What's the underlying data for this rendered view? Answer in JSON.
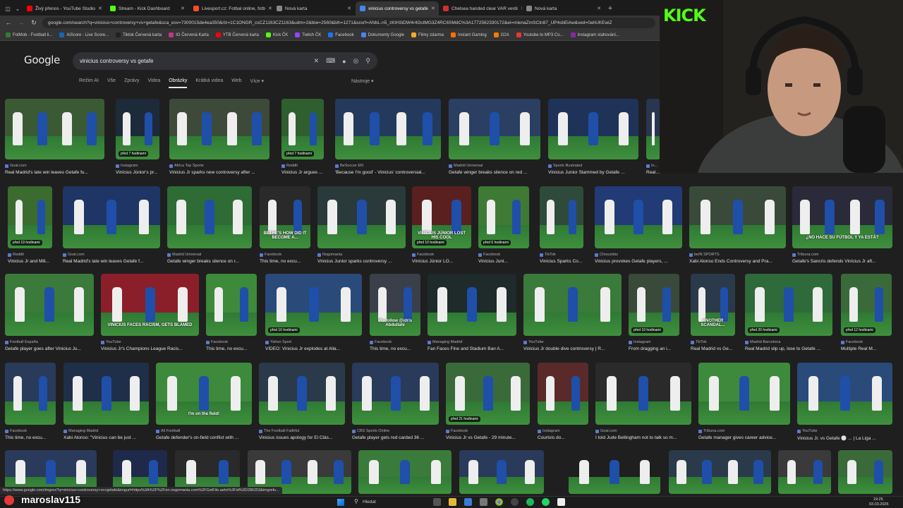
{
  "browser": {
    "tabs": [
      {
        "label": "Živý přenos - YouTube Studio",
        "color": "#ff0000"
      },
      {
        "label": "Stream - Kick Dashboard",
        "color": "#53fc18"
      },
      {
        "label": "Livesport.cz: Fotbal online, fotb",
        "color": "#ff4b2b"
      },
      {
        "label": "Nová karta",
        "color": "#888888"
      },
      {
        "label": "vinicius controversy vs getafe",
        "color": "#4285f4",
        "active": true
      },
      {
        "label": "Chelsea handed clear VAR verdi",
        "color": "#d32f2f"
      },
      {
        "label": "Nová karta",
        "color": "#888888"
      }
    ],
    "new_tab": "+",
    "url": "google.com/search?q=vinicius+controversy+vs+getafe&sca_esv=7300015de4ea350&rlz=1C1ONGR_csCZ1163CZ1163&udm=2&biw=2560&bih=1271&sxsrf=ANbL-n5_zKtH3iDW4r4GctMG3Z4RC6SMdC%3A1772562330172&ei=mienaZmSCtn87_UP4sbEiAw&ved=0ahUKEwiZ",
    "bookmarks": [
      {
        "label": "FotMob - Football li...",
        "color": "#2e7d32"
      },
      {
        "label": "AiScore - Live Score...",
        "color": "#1565c0"
      },
      {
        "label": "Tiktok Červená karta",
        "color": "#222222"
      },
      {
        "label": "IG Červená Karta",
        "color": "#c13584"
      },
      {
        "label": "YTB Červená karta",
        "color": "#ff0000"
      },
      {
        "label": "Kick ČK",
        "color": "#53fc18"
      },
      {
        "label": "Twitch ČK",
        "color": "#9146ff"
      },
      {
        "label": "Facebook",
        "color": "#1877f2"
      },
      {
        "label": "Dokumenty Google",
        "color": "#4285f4"
      },
      {
        "label": "Filmy zdarma",
        "color": "#f9a825"
      },
      {
        "label": "Instant Gaming",
        "color": "#ff6f00"
      },
      {
        "label": "G2A",
        "color": "#f57c00"
      },
      {
        "label": "Youtube to MP3 Co...",
        "color": "#e53935"
      },
      {
        "label": "Instagram stahování...",
        "color": "#8e24aa"
      }
    ]
  },
  "google": {
    "logo": "Google",
    "query": "vinicius controversy vs getafe",
    "tabs": [
      "Režim AI",
      "Vše",
      "Zprávy",
      "Videa",
      "Obrázky",
      "Krátká videa",
      "Web",
      "Více ▾"
    ],
    "active_tab": "Obrázky",
    "tools": "Nástroje ▾"
  },
  "images": [
    {
      "src": "Goal.com",
      "cap": "Real Madrid's late win leaves Getafe fu...",
      "c": "#3a5a34"
    },
    {
      "src": "Instagram",
      "cap": "Vinícius Júnior's pr...",
      "c": "#1d2a3a",
      "badge": "před 7 hodinami"
    },
    {
      "src": "Africa Top Sports",
      "cap": "Vinicius Jr sparks new controversy after ...",
      "c": "#3d4a3a"
    },
    {
      "src": "Reddit",
      "cap": "Vinicius Jr argues ...",
      "c": "#2f5f2f",
      "badge": "před 7 hodinami"
    },
    {
      "src": "BeSoccer EN",
      "cap": "'Because I'm good' - Vinicius' controversial...",
      "c": "#233a5c"
    },
    {
      "src": "Madrid Universal",
      "cap": "Getafe winger breaks silence on red ...",
      "c": "#2b3f63"
    },
    {
      "src": "Sports Illustrated",
      "cap": "Vinicius Junior Slammed by Getafe ...",
      "c": "#1f3358"
    },
    {
      "src": "In...",
      "cap": "Real Madrid's Vinicius Jr. accused of div...",
      "c": "#2a3550"
    },
    {
      "src": "Reddit",
      "cap": "Vinicius Jr and Mili...",
      "c": "#3b6b2f",
      "badge": "před 19 hodinami"
    },
    {
      "src": "Goal.com",
      "cap": "Real Madrid's late win leaves Getafe f...",
      "c": "#1f3566"
    },
    {
      "src": "Madrid Universal",
      "cap": "Getafe winger breaks silence on r...",
      "c": "#2e6b35"
    },
    {
      "src": "Facebook",
      "cap": "This time, no excu...",
      "c": "#2a2a2a",
      "text": "BETHE'S HOW DID IT BECOME A..."
    },
    {
      "src": "Nogomania",
      "cap": "Vinicius Junior sparks controversy ...",
      "c": "#2a3a3a"
    },
    {
      "src": "Facebook",
      "cap": "Vinícius Júnior LO...",
      "c": "#5a1f1f",
      "text": "VINÍCIUS JÚNIOR LOST HIS COOL",
      "badge": "před 10 hodinami"
    },
    {
      "src": "Facebook",
      "cap": "Vinícius Juni...",
      "c": "#3f7a35",
      "badge": "před 6 hodinami"
    },
    {
      "src": "TikTok",
      "cap": "Vinícius Sparks Co...",
      "c": "#2f4a3a"
    },
    {
      "src": "Chosunbiz",
      "cap": "Vinicius provokes Getafe players, ...",
      "c": "#223a75"
    },
    {
      "src": "beIN SPORTS",
      "cap": "Xabi Alonso Ends Controversy and Pra...",
      "c": "#3a4a3a"
    },
    {
      "src": "Tribuna.com",
      "cap": "Getafe's Sancris defends Vinícius Jr aft...",
      "c": "#2a2a3a",
      "text": "¿NO HACE SU FÚTBOL Y YA ESTÁ?"
    },
    {
      "src": "Football España",
      "cap": "Getafe player goes after Vinicius Ju...",
      "c": "#3b7a3a"
    },
    {
      "src": "YouTube",
      "cap": "Vinicius Jr's Champions League Racis...",
      "c": "#8a1f2a",
      "text": "VINICIUS FACES RACISM, GETS BLAMED"
    },
    {
      "src": "Facebook",
      "cap": "This time, no excu...",
      "c": "#3d8a3a"
    },
    {
      "src": "Yahoo Sport",
      "cap": "VIDEO: Vinicius Jr explodes at Alla...",
      "c": "#2a4a7a",
      "badge": "před 10 hodinami"
    },
    {
      "src": "Facebook",
      "cap": "This time, no excu...",
      "c": "#3a3f4a",
      "text": "Pls follow @idris Abdullahi"
    },
    {
      "src": "Managing Madrid",
      "cap": "Fan Faces Fine and Stadium Ban A...",
      "c": "#1f2a2a"
    },
    {
      "src": "YouTube",
      "cap": "Vinicius Jr double dive controversy | R...",
      "c": "#3a7a3a"
    },
    {
      "src": "Instagram",
      "cap": "From dragging an i...",
      "c": "#3a4a3a",
      "badge": "před 19 hodinami"
    },
    {
      "src": "TikTok",
      "cap": "Real Madrid vs Ge...",
      "c": "#2a3a4a",
      "text": "ANOTHER SCANDAL..."
    },
    {
      "src": "Madrid-Barcelona",
      "cap": "Real Madrid slip up, lose to Getafe ...",
      "c": "#2f6a3a",
      "badge": "před 20 hodinami"
    },
    {
      "src": "Facebook",
      "cap": "Multiple Real M...",
      "c": "#3a6a3a",
      "badge": "před 12 hodinami"
    },
    {
      "src": "Facebook",
      "cap": "This time, no excu...",
      "c": "#2a3a5a"
    },
    {
      "src": "Managing Madrid",
      "cap": "Xabi Alonso: \"Vinicius can be just ...",
      "c": "#1f2f4a"
    },
    {
      "src": "All Football",
      "cap": "Getafe defender's on-field conflict with ...",
      "c": "#3d8a3d",
      "text": "I'm on the field!"
    },
    {
      "src": "The Football Faithful",
      "cap": "Vinicius issues apology for El Clás...",
      "c": "#2a3a4a"
    },
    {
      "src": "CBS Sports Online",
      "cap": "Getafe player gets red carded 36 ...",
      "c": "#2a3a5a"
    },
    {
      "src": "Facebook",
      "cap": "Vinicius Jr vs Getafe - 29 minute...",
      "c": "#3a6a3a",
      "badge": "před 21 hodinami"
    },
    {
      "src": "Instagram",
      "cap": "Courtois do...",
      "c": "#5a2a2a"
    },
    {
      "src": "Goal.com",
      "cap": "I told Jude Bellingham not to talk so m...",
      "c": "#2a2a2a"
    },
    {
      "src": "Tribuna.com",
      "cap": "Getafe manager gives career advice...",
      "c": "#3d8a3d"
    },
    {
      "src": "YouTube",
      "cap": "Vinicius Jr. vs Getafe ⚪ ... | La Liga ...",
      "c": "#2a4a7a"
    },
    {
      "src": "",
      "cap": "",
      "c": "#2a3a5a"
    },
    {
      "src": "",
      "cap": "",
      "c": "#1f2a4a"
    },
    {
      "src": "",
      "cap": "",
      "c": "#2a2a2a"
    },
    {
      "src": "",
      "cap": "",
      "c": "#3a3a3a"
    },
    {
      "src": "",
      "cap": "",
      "c": "#3a7a3a"
    },
    {
      "src": "",
      "cap": "",
      "c": "#2a3a5a"
    },
    {
      "src": "",
      "cap": "",
      "c": "#1f1f1f"
    },
    {
      "src": "",
      "cap": "",
      "c": "#2a3a4a"
    },
    {
      "src": "",
      "cap": "",
      "c": "#3a3a3a"
    },
    {
      "src": "",
      "cap": "",
      "c": "#3a6a3a"
    }
  ],
  "overlay": {
    "kick_logo": "KICK",
    "streamer_name": "maroslav115"
  },
  "statusbar": {
    "link": "https://www.google.com/imgres?q=vinicius+controversy+vs+getafe&imgurl=https%3A%2F%2Fen.nogomania.com%2FGetFile.ashx%3Fid%3D286253&imgrefu..."
  },
  "taskbar": {
    "search": "Hledat",
    "time": "19:25",
    "date": "03.03.2026"
  }
}
